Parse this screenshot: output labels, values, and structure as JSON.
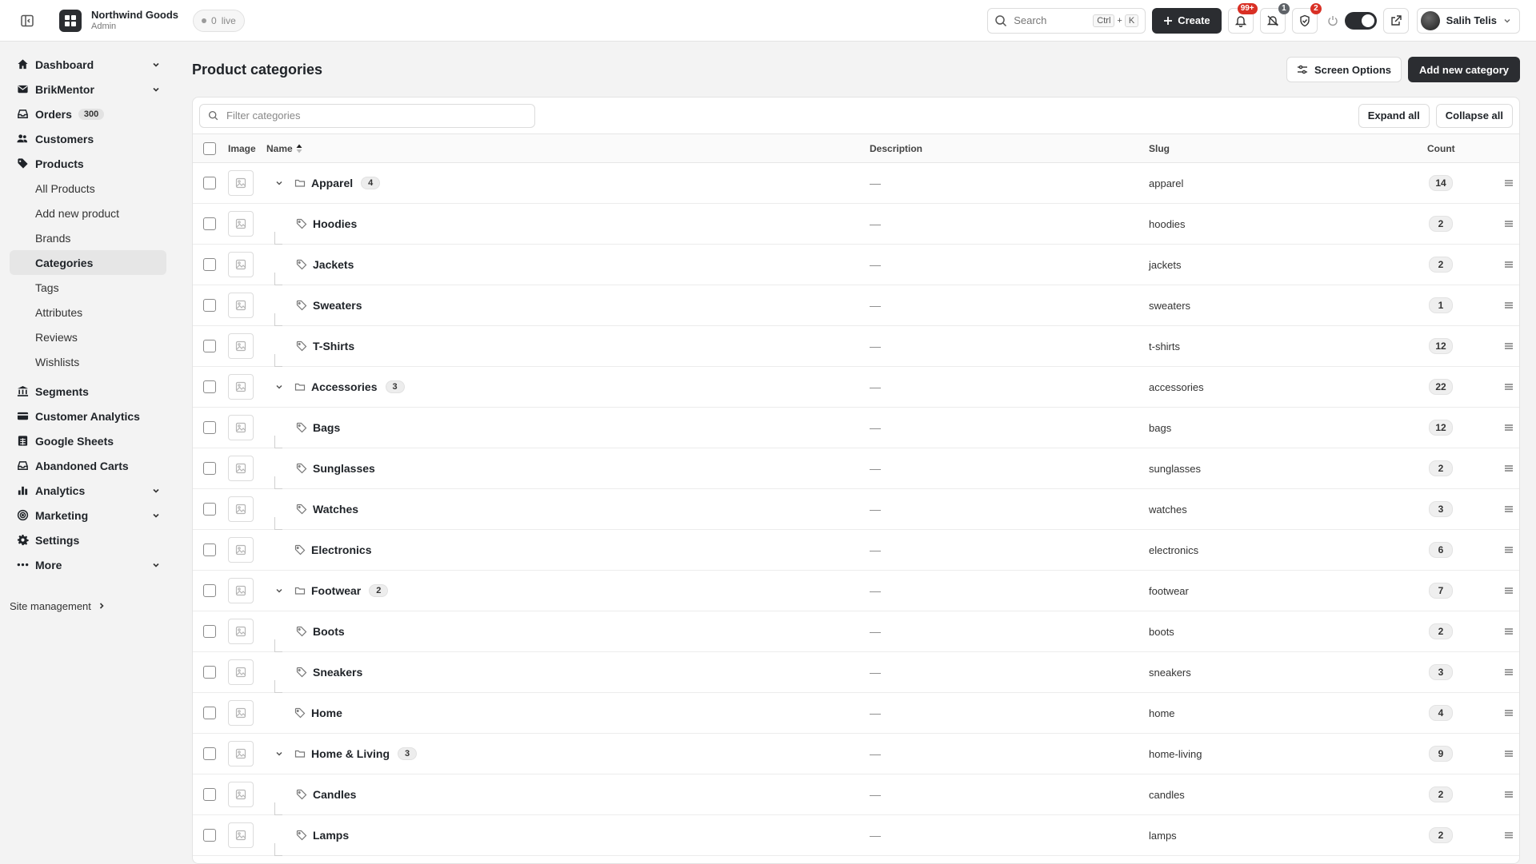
{
  "app": {
    "name": "Northwind Goods",
    "role": "Admin",
    "live_count": "0",
    "live_label": "live"
  },
  "topbar": {
    "search_placeholder": "Search",
    "shortcut_ctrl": "Ctrl",
    "shortcut_plus": "+",
    "shortcut_key": "K",
    "create_label": "Create",
    "notifications_badge": "99+",
    "muted_badge": "1",
    "tasks_badge": "2",
    "user_name": "Salih Telis"
  },
  "sidebar": {
    "items": [
      {
        "label": "Dashboard",
        "icon": "home-icon",
        "chevron": true
      },
      {
        "label": "BrikMentor",
        "icon": "mail-icon",
        "chevron": true
      },
      {
        "label": "Orders",
        "icon": "inbox-icon",
        "count": "300"
      },
      {
        "label": "Customers",
        "icon": "users-icon"
      },
      {
        "label": "Products",
        "icon": "tag-icon"
      }
    ],
    "products_sub": [
      "All Products",
      "Add new product",
      "Brands",
      "Categories",
      "Tags",
      "Attributes",
      "Reviews",
      "Wishlists"
    ],
    "items2": [
      {
        "label": "Segments",
        "icon": "bank-icon"
      },
      {
        "label": "Customer Analytics",
        "icon": "card-icon"
      },
      {
        "label": "Google Sheets",
        "icon": "sheet-icon"
      },
      {
        "label": "Abandoned Carts",
        "icon": "inbox-icon"
      },
      {
        "label": "Analytics",
        "icon": "bar-chart-icon",
        "chevron": true
      },
      {
        "label": "Marketing",
        "icon": "target-icon",
        "chevron": true
      },
      {
        "label": "Settings",
        "icon": "gear-icon"
      },
      {
        "label": "More",
        "icon": "dots-icon",
        "chevron": true
      }
    ],
    "site_management": "Site management"
  },
  "page": {
    "title": "Product categories",
    "screen_options": "Screen Options",
    "add_new": "Add new category",
    "filter_placeholder": "Filter categories",
    "expand_all": "Expand all",
    "collapse_all": "Collapse all"
  },
  "table": {
    "columns": {
      "image": "Image",
      "name": "Name",
      "description": "Description",
      "slug": "Slug",
      "count": "Count"
    },
    "rows": [
      {
        "name": "Apparel",
        "level": 0,
        "parent": true,
        "children": "4",
        "description": "—",
        "slug": "apparel",
        "count": "14"
      },
      {
        "name": "Hoodies",
        "level": 1,
        "parent": false,
        "description": "—",
        "slug": "hoodies",
        "count": "2"
      },
      {
        "name": "Jackets",
        "level": 1,
        "parent": false,
        "description": "—",
        "slug": "jackets",
        "count": "2"
      },
      {
        "name": "Sweaters",
        "level": 1,
        "parent": false,
        "description": "—",
        "slug": "sweaters",
        "count": "1"
      },
      {
        "name": "T-Shirts",
        "level": 1,
        "parent": false,
        "description": "—",
        "slug": "t-shirts",
        "count": "12"
      },
      {
        "name": "Accessories",
        "level": 0,
        "parent": true,
        "children": "3",
        "description": "—",
        "slug": "accessories",
        "count": "22"
      },
      {
        "name": "Bags",
        "level": 1,
        "parent": false,
        "description": "—",
        "slug": "bags",
        "count": "12"
      },
      {
        "name": "Sunglasses",
        "level": 1,
        "parent": false,
        "description": "—",
        "slug": "sunglasses",
        "count": "2"
      },
      {
        "name": "Watches",
        "level": 1,
        "parent": false,
        "description": "—",
        "slug": "watches",
        "count": "3"
      },
      {
        "name": "Electronics",
        "level": 0,
        "parent": false,
        "description": "—",
        "slug": "electronics",
        "count": "6"
      },
      {
        "name": "Footwear",
        "level": 0,
        "parent": true,
        "children": "2",
        "description": "—",
        "slug": "footwear",
        "count": "7"
      },
      {
        "name": "Boots",
        "level": 1,
        "parent": false,
        "description": "—",
        "slug": "boots",
        "count": "2"
      },
      {
        "name": "Sneakers",
        "level": 1,
        "parent": false,
        "description": "—",
        "slug": "sneakers",
        "count": "3"
      },
      {
        "name": "Home",
        "level": 0,
        "parent": false,
        "description": "—",
        "slug": "home",
        "count": "4"
      },
      {
        "name": "Home & Living",
        "level": 0,
        "parent": true,
        "children": "3",
        "description": "—",
        "slug": "home-living",
        "count": "9"
      },
      {
        "name": "Candles",
        "level": 1,
        "parent": false,
        "description": "—",
        "slug": "candles",
        "count": "2"
      },
      {
        "name": "Lamps",
        "level": 1,
        "parent": false,
        "description": "—",
        "slug": "lamps",
        "count": "2"
      }
    ]
  }
}
